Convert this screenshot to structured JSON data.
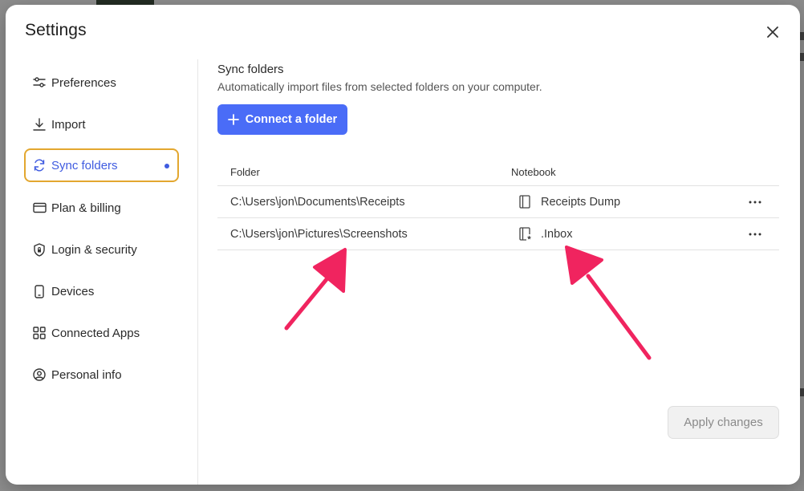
{
  "modal": {
    "title": "Settings",
    "close_icon": "close-icon"
  },
  "sidebar": {
    "items": [
      {
        "label": "Preferences",
        "icon": "sliders-icon"
      },
      {
        "label": "Import",
        "icon": "download-icon"
      },
      {
        "label": "Sync folders",
        "icon": "sync-icon",
        "active": true
      },
      {
        "label": "Plan & billing",
        "icon": "credit-card-icon"
      },
      {
        "label": "Login & security",
        "icon": "shield-lock-icon"
      },
      {
        "label": "Devices",
        "icon": "phone-icon"
      },
      {
        "label": "Connected Apps",
        "icon": "apps-grid-icon"
      },
      {
        "label": "Personal info",
        "icon": "user-circle-icon"
      }
    ]
  },
  "main": {
    "title": "Sync folders",
    "description": "Automatically import files from selected folders on your computer.",
    "connect_label": "Connect a folder",
    "table": {
      "headers": {
        "folder": "Folder",
        "notebook": "Notebook"
      },
      "rows": [
        {
          "folder": "C:\\Users\\jon\\Documents\\Receipts",
          "notebook": "Receipts Dump",
          "notebook_icon": "notebook-icon"
        },
        {
          "folder": "C:\\Users\\jon\\Pictures\\Screenshots",
          "notebook": ".Inbox",
          "notebook_icon": "notebook-star-icon"
        }
      ]
    },
    "apply_label": "Apply changes"
  },
  "colors": {
    "accent": "#4a6cf7",
    "active_text": "#3f5be0",
    "active_border": "#e3a72f",
    "annotation_arrow": "#f0245f"
  }
}
